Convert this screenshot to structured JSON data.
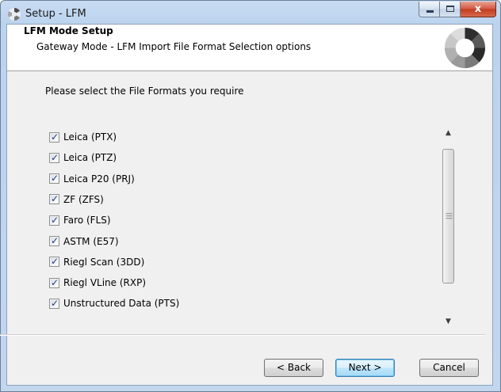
{
  "window": {
    "title": "Setup - LFM",
    "minimize_glyph": "",
    "maximize_glyph": "",
    "close_glyph": "x"
  },
  "header": {
    "title": "LFM Mode Setup",
    "subtitle": "Gateway Mode - LFM Import File Format Selection options"
  },
  "content": {
    "prompt": "Please select the File Formats you require",
    "formats": [
      {
        "label": "Leica (PTX)",
        "checked": true
      },
      {
        "label": "Leica  (PTZ)",
        "checked": true
      },
      {
        "label": "Leica P20 (PRJ)",
        "checked": true
      },
      {
        "label": "ZF  (ZFS)",
        "checked": true
      },
      {
        "label": "Faro  (FLS)",
        "checked": true
      },
      {
        "label": "ASTM (E57)",
        "checked": true
      },
      {
        "label": "Riegl Scan (3DD)",
        "checked": true
      },
      {
        "label": "Riegl VLine (RXP)",
        "checked": true
      },
      {
        "label": "Unstructured Data (PTS)",
        "checked": true
      },
      {
        "label": "",
        "checked": false
      }
    ]
  },
  "buttons": {
    "back": "< Back",
    "next": "Next >",
    "cancel": "Cancel"
  },
  "icons": {
    "app": "setup-spinner-icon",
    "logo": "setup-spinner-logo",
    "check": "✓"
  }
}
